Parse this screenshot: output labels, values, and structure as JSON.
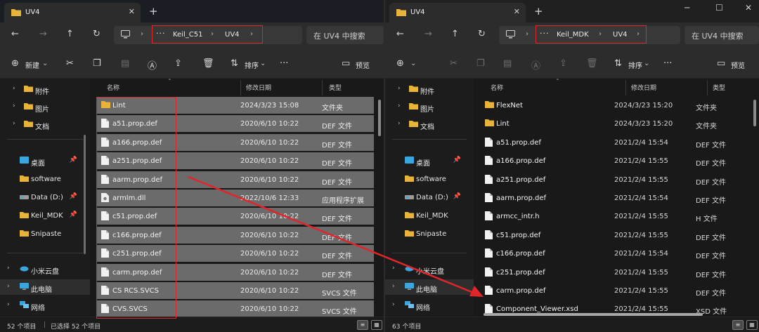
{
  "left": {
    "tab_title": "UV4",
    "breadcrumb": [
      "Keil_C51",
      "UV4"
    ],
    "search_placeholder": "在 UV4 中搜索",
    "cmd": {
      "new_label": "新建",
      "sort_label": "排序",
      "preview_label": "预览"
    },
    "nav": {
      "quick": [
        "附件",
        "图片",
        "文档"
      ],
      "pinned": [
        {
          "label": "桌面",
          "pinned": true
        },
        {
          "label": "software",
          "pinned": false
        },
        {
          "label": "Data (D:)",
          "pinned": true
        },
        {
          "label": "Keil_MDK",
          "pinned": true
        },
        {
          "label": "Snipaste",
          "pinned": false
        }
      ],
      "bottom": [
        "小米云盘",
        "此电脑",
        "网络"
      ]
    },
    "columns": [
      "名称",
      "修改日期",
      "类型"
    ],
    "files": [
      {
        "name": "Lint",
        "date": "2024/3/23 15:08",
        "type": "文件夹",
        "kind": "folder"
      },
      {
        "name": "a51.prop.def",
        "date": "2020/6/10 10:22",
        "type": "DEF 文件",
        "kind": "file"
      },
      {
        "name": "a166.prop.def",
        "date": "2020/6/10 10:22",
        "type": "DEF 文件",
        "kind": "file"
      },
      {
        "name": "a251.prop.def",
        "date": "2020/6/10 10:22",
        "type": "DEF 文件",
        "kind": "file"
      },
      {
        "name": "aarm.prop.def",
        "date": "2020/6/10 10:22",
        "type": "DEF 文件",
        "kind": "file"
      },
      {
        "name": "armlm.dll",
        "date": "2022/10/6 12:33",
        "type": "应用程序扩展",
        "kind": "dll"
      },
      {
        "name": "c51.prop.def",
        "date": "2020/6/10 10:22",
        "type": "DEF 文件",
        "kind": "file"
      },
      {
        "name": "c166.prop.def",
        "date": "2020/6/10 10:22",
        "type": "DEF 文件",
        "kind": "file"
      },
      {
        "name": "c251.prop.def",
        "date": "2020/6/10 10:22",
        "type": "DEF 文件",
        "kind": "file"
      },
      {
        "name": "carm.prop.def",
        "date": "2020/6/10 10:22",
        "type": "DEF 文件",
        "kind": "file"
      },
      {
        "name": "CS RCS.SVCS",
        "date": "2020/6/10 10:22",
        "type": "SVCS 文件",
        "kind": "file"
      },
      {
        "name": "CVS.SVCS",
        "date": "2020/6/10 10:22",
        "type": "SVCS 文件",
        "kind": "file"
      }
    ],
    "status": {
      "count": "52 个项目",
      "selected": "已选择 52 个项目"
    }
  },
  "right": {
    "tab_title": "UV4",
    "breadcrumb": [
      "Keil_MDK",
      "UV4"
    ],
    "search_placeholder": "在 UV4 中搜索",
    "cmd": {
      "sort_label": "排序",
      "preview_label": "预览"
    },
    "nav": {
      "quick": [
        "附件",
        "图片",
        "文档"
      ],
      "pinned": [
        {
          "label": "桌面",
          "pinned": true
        },
        {
          "label": "software",
          "pinned": false
        },
        {
          "label": "Data (D:)",
          "pinned": true
        },
        {
          "label": "Keil_MDK",
          "pinned": false
        },
        {
          "label": "Snipaste",
          "pinned": false
        }
      ],
      "bottom": [
        "小米云盘",
        "此电脑",
        "网络"
      ]
    },
    "columns": [
      "名称",
      "修改日期",
      "类型"
    ],
    "files": [
      {
        "name": "FlexNet",
        "date": "2024/3/23 15:20",
        "type": "文件夹",
        "kind": "folder"
      },
      {
        "name": "Lint",
        "date": "2024/3/23 15:20",
        "type": "文件夹",
        "kind": "folder"
      },
      {
        "name": "a51.prop.def",
        "date": "2021/2/4 15:54",
        "type": "DEF 文件",
        "kind": "file"
      },
      {
        "name": "a166.prop.def",
        "date": "2021/2/4 15:55",
        "type": "DEF 文件",
        "kind": "file"
      },
      {
        "name": "a251.prop.def",
        "date": "2021/2/4 15:55",
        "type": "DEF 文件",
        "kind": "file"
      },
      {
        "name": "aarm.prop.def",
        "date": "2021/2/4 15:54",
        "type": "DEF 文件",
        "kind": "file"
      },
      {
        "name": "armcc_intr.h",
        "date": "2021/2/4 15:55",
        "type": "H 文件",
        "kind": "file"
      },
      {
        "name": "c51.prop.def",
        "date": "2021/2/4 15:55",
        "type": "DEF 文件",
        "kind": "file"
      },
      {
        "name": "c166.prop.def",
        "date": "2021/2/4 15:54",
        "type": "DEF 文件",
        "kind": "file"
      },
      {
        "name": "c251.prop.def",
        "date": "2021/2/4 15:55",
        "type": "DEF 文件",
        "kind": "file"
      },
      {
        "name": "carm.prop.def",
        "date": "2021/2/4 15:55",
        "type": "DEF 文件",
        "kind": "file"
      },
      {
        "name": "Component_Viewer.xsd",
        "date": "2021/2/4 15:55",
        "type": "XSD 文件",
        "kind": "file"
      }
    ],
    "status": {
      "count": "63 个项目"
    }
  },
  "colors": {
    "highlight_red": "#e0262a",
    "folder_yellow": "#e8b339",
    "selection_gray": "#6b6b6b"
  }
}
